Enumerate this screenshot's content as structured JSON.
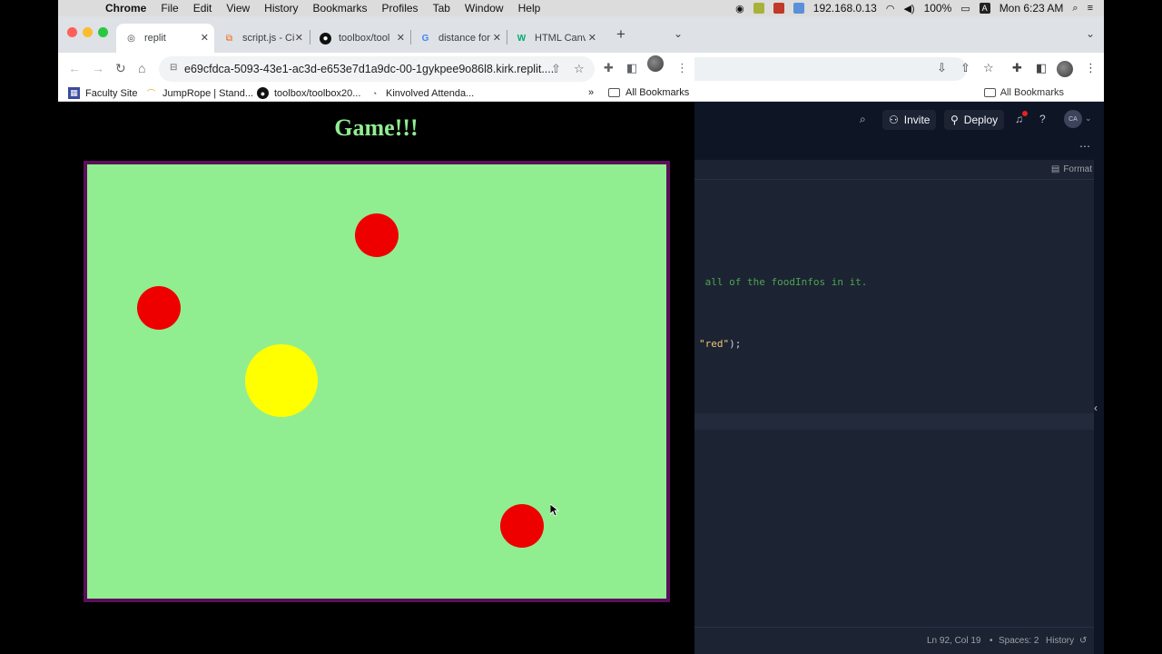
{
  "menubar": {
    "app": "Chrome",
    "items": [
      "File",
      "Edit",
      "View",
      "History",
      "Bookmarks",
      "Profiles",
      "Tab",
      "Window",
      "Help"
    ],
    "ip": "192.168.0.13",
    "battery": "100%",
    "clock": "Mon 6:23 AM"
  },
  "browser": {
    "tabs": [
      {
        "label": "replit",
        "icon": "globe-icon"
      },
      {
        "label": "script.js - Ci",
        "icon": "replit-icon"
      },
      {
        "label": "toolbox/tool",
        "icon": "github-icon"
      },
      {
        "label": "distance for",
        "icon": "google-icon"
      },
      {
        "label": "HTML Canv",
        "icon": "w3schools-icon"
      }
    ],
    "url": "e69cfdca-5093-43e1-ac3d-e653e7d1a9dc-00-1gykpee9o86l8.kirk.replit....",
    "bookmarks": [
      {
        "label": "Faculty Site",
        "icon": "calendar-icon"
      },
      {
        "label": "JumpRope | Stand...",
        "icon": "jumprope-icon"
      },
      {
        "label": "toolbox/toolbox20...",
        "icon": "github-icon"
      },
      {
        "label": "Kinvolved Attenda...",
        "icon": "kinvolved-icon"
      }
    ],
    "bookmarks_overflow": "»",
    "all_bookmarks": "All Bookmarks"
  },
  "page": {
    "title": "Game!!!",
    "canvas_color": "#90ee90",
    "border_color": "#5a0f5a",
    "balls": [
      {
        "name": "red-food-ball-top",
        "color": "#ee0000"
      },
      {
        "name": "red-food-ball-left",
        "color": "#ee0000"
      },
      {
        "name": "yellow-player-ball",
        "color": "#ffff00"
      },
      {
        "name": "red-food-ball-bottom",
        "color": "#ee0000"
      }
    ]
  },
  "back_browser": {
    "all_bookmarks": "All Bookmarks"
  },
  "replit": {
    "invite": "Invite",
    "deploy": "Deploy",
    "format": "Format",
    "code": {
      "comment_line": " all of the foodInfos in it.",
      "string_token": "\"red\"",
      "punct_token": ");"
    },
    "status": {
      "position": "Ln 92, Col 19",
      "spaces": "Spaces: 2",
      "history": "History"
    }
  }
}
